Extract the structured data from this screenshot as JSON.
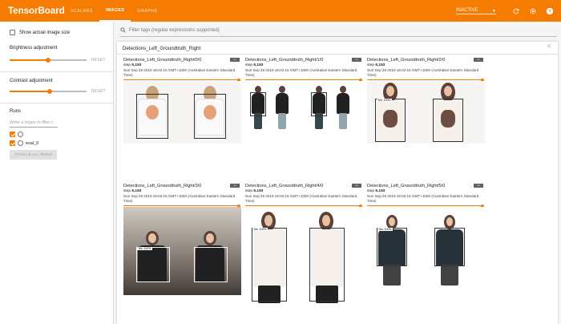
{
  "header": {
    "brand": "TensorBoard",
    "tabs": [
      {
        "label": "SCALARS",
        "active": false
      },
      {
        "label": "IMAGES",
        "active": true
      },
      {
        "label": "GRAPHS",
        "active": false
      }
    ],
    "status": "INACTIVE",
    "icons": [
      "refresh-icon",
      "settings-icon",
      "help-icon"
    ],
    "accent_color": "#f57c00"
  },
  "sidebar": {
    "show_actual_size": "Show actual image size",
    "brightness_label": "Brightness adjustment",
    "brightness_value": 0.5,
    "contrast_label": "Contrast adjustment",
    "contrast_value": 0.52,
    "reset_label": "RESET",
    "runs_label": "Runs",
    "regex_placeholder": "Write a regex to filter r...",
    "runs": [
      {
        "name": "",
        "checked": true
      },
      {
        "name": "eval_0",
        "checked": true
      }
    ],
    "toggle_label": "TOGGLE ALL RUNS"
  },
  "main": {
    "filter_placeholder": "Filter tags (regular expressions supported)",
    "card_title": "Detections_Left_Groundtruth_Right",
    "panes": [
      {
        "title": "Detections_Left_Groundtruth_Right/0/0",
        "step_label": "step",
        "step": "6,193",
        "time": "Sun Sep 29 2019 16:02:15 GMT+1000 (Australian Eastern Standard Time)"
      },
      {
        "title": "Detections_Left_Groundtruth_Right/1/0",
        "step_label": "step",
        "step": "6,193",
        "time": "Sun Sep 29 2019 16:02:15 GMT+1000 (Australian Eastern Standard Time)"
      },
      {
        "title": "Detections_Left_Groundtruth_Right/2/0",
        "step_label": "step",
        "step": "6,193",
        "time": "Sun Sep 29 2019 16:02:15 GMT+1000 (Australian Eastern Standard Time)"
      },
      {
        "title": "Detections_Left_Groundtruth_Right/3/0",
        "step_label": "step",
        "step": "6,193",
        "time": "Sun Sep 29 2019 16:02:15 GMT+1000 (Australian Eastern Standard Time)"
      },
      {
        "title": "Detections_Left_Groundtruth_Right/4/0",
        "step_label": "step",
        "step": "6,193",
        "time": "Sun Sep 29 2019 16:02:15 GMT+1000 (Australian Eastern Standard Time)"
      },
      {
        "title": "Detections_Left_Groundtruth_Right/5/0",
        "step_label": "step",
        "step": "6,193",
        "time": "Sun Sep 29 2019 16:02:15 GMT+1000 (Australian Eastern Standard Time)"
      }
    ],
    "box_labels": [
      "Tee: 100%",
      "Tee: 100%",
      "Tee: 100%",
      "Tee: 100%"
    ]
  }
}
